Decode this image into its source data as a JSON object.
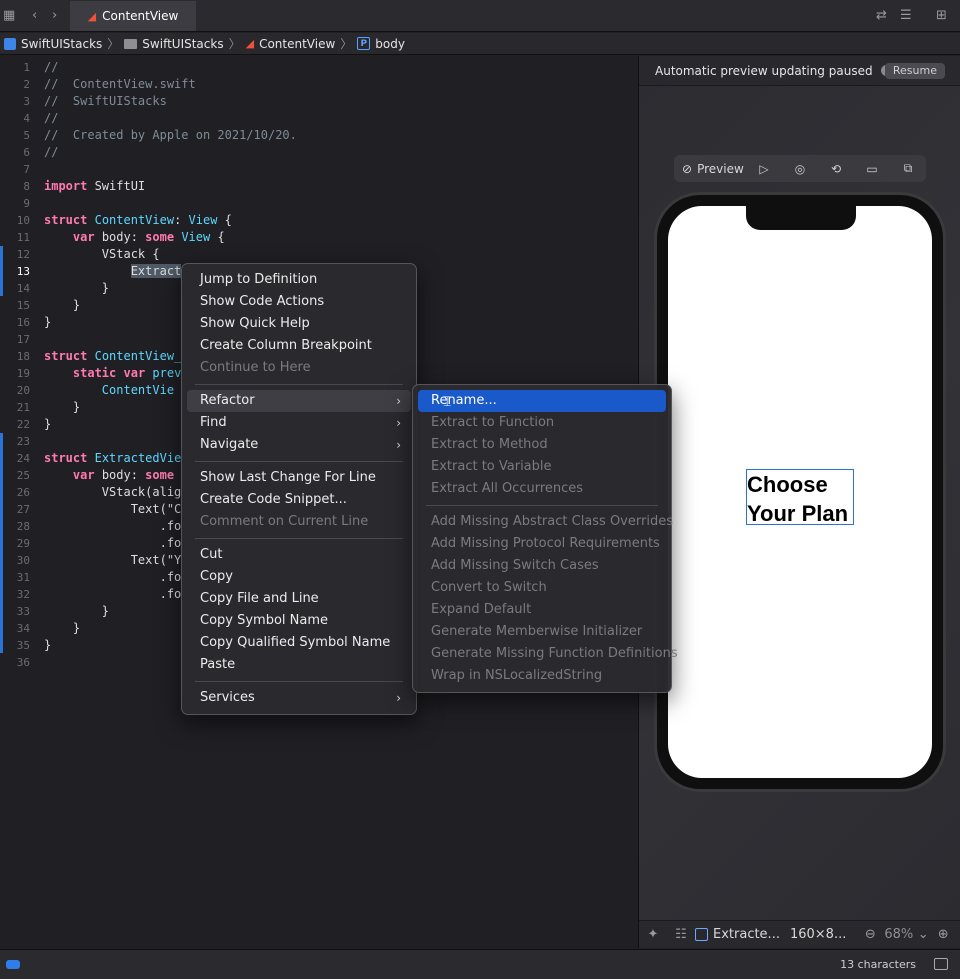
{
  "tabbar": {
    "active_tab": "ContentView"
  },
  "breadcrumb": [
    "SwiftUIStacks",
    "SwiftUIStacks",
    "ContentView",
    "body"
  ],
  "code_lines": [
    {
      "n": "1",
      "parts": [
        [
          "c-com",
          "//"
        ]
      ]
    },
    {
      "n": "2",
      "parts": [
        [
          "c-com",
          "//  ContentView.swift"
        ]
      ]
    },
    {
      "n": "3",
      "parts": [
        [
          "c-com",
          "//  SwiftUIStacks"
        ]
      ]
    },
    {
      "n": "4",
      "parts": [
        [
          "c-com",
          "//"
        ]
      ]
    },
    {
      "n": "5",
      "parts": [
        [
          "c-com",
          "//  Created by Apple on 2021/10/20."
        ]
      ]
    },
    {
      "n": "6",
      "parts": [
        [
          "c-com",
          "//"
        ]
      ]
    },
    {
      "n": "7",
      "parts": []
    },
    {
      "n": "8",
      "parts": [
        [
          "c-kw",
          "import"
        ],
        [
          "c-plain",
          " SwiftUI"
        ]
      ]
    },
    {
      "n": "9",
      "parts": []
    },
    {
      "n": "10",
      "parts": [
        [
          "c-kw",
          "struct"
        ],
        [
          "c-plain",
          " "
        ],
        [
          "c-type",
          "ContentView"
        ],
        [
          "c-plain",
          ": "
        ],
        [
          "c-type",
          "View"
        ],
        [
          "c-plain",
          " {"
        ]
      ]
    },
    {
      "n": "11",
      "parts": [
        [
          "c-plain",
          "    "
        ],
        [
          "c-kw",
          "var"
        ],
        [
          "c-plain",
          " body: "
        ],
        [
          "c-kw",
          "some"
        ],
        [
          "c-plain",
          " "
        ],
        [
          "c-type",
          "View"
        ],
        [
          "c-plain",
          " {"
        ]
      ]
    },
    {
      "n": "12",
      "parts": [
        [
          "c-plain",
          "        VStack {"
        ]
      ]
    },
    {
      "n": "13",
      "parts": [
        [
          "c-plain",
          "            "
        ],
        [
          "c-sel",
          "Extract"
        ]
      ]
    },
    {
      "n": "14",
      "parts": [
        [
          "c-plain",
          "        }"
        ]
      ]
    },
    {
      "n": "15",
      "parts": [
        [
          "c-plain",
          "    }"
        ]
      ]
    },
    {
      "n": "16",
      "parts": [
        [
          "c-plain",
          "}"
        ]
      ]
    },
    {
      "n": "17",
      "parts": []
    },
    {
      "n": "18",
      "parts": [
        [
          "c-kw",
          "struct"
        ],
        [
          "c-plain",
          " "
        ],
        [
          "c-type",
          "ContentView_"
        ]
      ]
    },
    {
      "n": "19",
      "parts": [
        [
          "c-plain",
          "    "
        ],
        [
          "c-kw",
          "static"
        ],
        [
          "c-plain",
          " "
        ],
        [
          "c-kw",
          "var"
        ],
        [
          "c-plain",
          " "
        ],
        [
          "c-type",
          "prev"
        ]
      ]
    },
    {
      "n": "20",
      "parts": [
        [
          "c-plain",
          "        "
        ],
        [
          "c-type",
          "ContentVie"
        ]
      ]
    },
    {
      "n": "21",
      "parts": [
        [
          "c-plain",
          "    }"
        ]
      ]
    },
    {
      "n": "22",
      "parts": [
        [
          "c-plain",
          "}"
        ]
      ]
    },
    {
      "n": "23",
      "parts": []
    },
    {
      "n": "24",
      "parts": [
        [
          "c-kw",
          "struct"
        ],
        [
          "c-plain",
          " "
        ],
        [
          "c-type",
          "ExtractedVie"
        ]
      ]
    },
    {
      "n": "25",
      "parts": [
        [
          "c-plain",
          "    "
        ],
        [
          "c-kw",
          "var"
        ],
        [
          "c-plain",
          " body: "
        ],
        [
          "c-kw",
          "some"
        ]
      ]
    },
    {
      "n": "26",
      "parts": [
        [
          "c-plain",
          "        VStack(alig"
        ]
      ]
    },
    {
      "n": "27",
      "parts": [
        [
          "c-plain",
          "            Text(\"C"
        ]
      ]
    },
    {
      "n": "28",
      "parts": [
        [
          "c-plain",
          "                .fo"
        ]
      ]
    },
    {
      "n": "29",
      "parts": [
        [
          "c-plain",
          "                .fo"
        ]
      ]
    },
    {
      "n": "30",
      "parts": [
        [
          "c-plain",
          "            Text(\"Y"
        ]
      ]
    },
    {
      "n": "31",
      "parts": [
        [
          "c-plain",
          "                .fo"
        ]
      ]
    },
    {
      "n": "32",
      "parts": [
        [
          "c-plain",
          "                .fo"
        ]
      ]
    },
    {
      "n": "33",
      "parts": [
        [
          "c-plain",
          "        }"
        ]
      ]
    },
    {
      "n": "34",
      "parts": [
        [
          "c-plain",
          "    }"
        ]
      ]
    },
    {
      "n": "35",
      "parts": [
        [
          "c-plain",
          "}"
        ]
      ]
    },
    {
      "n": "36",
      "parts": []
    }
  ],
  "preview": {
    "status": "Automatic preview updating paused",
    "resume_label": "Resume",
    "toolbar_preview_label": "Preview",
    "preview_text_line1": "Choose",
    "preview_text_line2": "Your Plan",
    "bottom_item_name": "Extracte...",
    "bottom_item_size": "160×8...",
    "zoom": "68%"
  },
  "context_menu": {
    "items": [
      {
        "label": "Jump to Definition",
        "disabled": false
      },
      {
        "label": "Show Code Actions",
        "disabled": false
      },
      {
        "label": "Show Quick Help",
        "disabled": false
      },
      {
        "label": "Create Column Breakpoint",
        "disabled": false
      },
      {
        "label": "Continue to Here",
        "disabled": true
      },
      {
        "sep": true
      },
      {
        "label": "Refactor",
        "disabled": false,
        "submenu": true,
        "selected": true
      },
      {
        "label": "Find",
        "disabled": false,
        "submenu": true
      },
      {
        "label": "Navigate",
        "disabled": false,
        "submenu": true
      },
      {
        "sep": true
      },
      {
        "label": "Show Last Change For Line",
        "disabled": false
      },
      {
        "label": "Create Code Snippet...",
        "disabled": false
      },
      {
        "label": "Comment on Current Line",
        "disabled": true
      },
      {
        "sep": true
      },
      {
        "label": "Cut",
        "disabled": false
      },
      {
        "label": "Copy",
        "disabled": false
      },
      {
        "label": "Copy File and Line",
        "disabled": false
      },
      {
        "label": "Copy Symbol Name",
        "disabled": false
      },
      {
        "label": "Copy Qualified Symbol Name",
        "disabled": false
      },
      {
        "label": "Paste",
        "disabled": false
      },
      {
        "sep": true
      },
      {
        "label": "Services",
        "disabled": false,
        "submenu": true
      }
    ]
  },
  "refactor_menu": {
    "items": [
      {
        "label": "Rename...",
        "disabled": false,
        "highlighted": true
      },
      {
        "label": "Extract to Function",
        "disabled": true
      },
      {
        "label": "Extract to Method",
        "disabled": true
      },
      {
        "label": "Extract to Variable",
        "disabled": true
      },
      {
        "label": "Extract All Occurrences",
        "disabled": true
      },
      {
        "sep": true
      },
      {
        "label": "Add Missing Abstract Class Overrides",
        "disabled": true
      },
      {
        "label": "Add Missing Protocol Requirements",
        "disabled": true
      },
      {
        "label": "Add Missing Switch Cases",
        "disabled": true
      },
      {
        "label": "Convert to Switch",
        "disabled": true
      },
      {
        "label": "Expand Default",
        "disabled": true
      },
      {
        "label": "Generate Memberwise Initializer",
        "disabled": true
      },
      {
        "label": "Generate Missing Function Definitions",
        "disabled": true
      },
      {
        "label": "Wrap in NSLocalizedString",
        "disabled": true
      }
    ]
  },
  "statusbar": {
    "char_count": "13 characters"
  },
  "colors": {
    "accent": "#1959c9",
    "keyword": "#ff7ab2",
    "type": "#5dd8ff",
    "comment": "#7f8c98"
  }
}
